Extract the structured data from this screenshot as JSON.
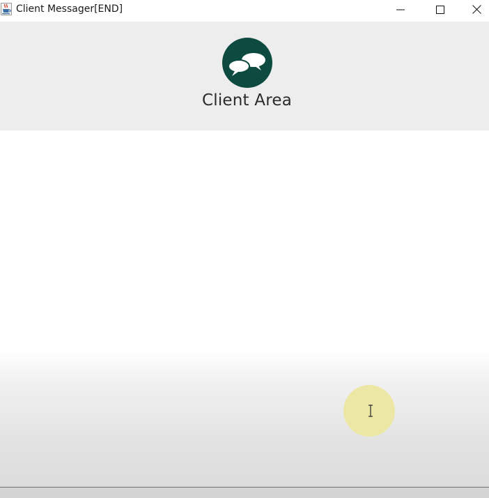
{
  "window": {
    "title": "Client Messager[END]",
    "app_icon": "java-cup-icon",
    "controls": {
      "minimize": "minimize-icon",
      "maximize": "maximize-icon",
      "close": "close-icon"
    }
  },
  "header": {
    "logo": "chat-bubbles-icon",
    "title": "Client Area",
    "background_color": "#eeedee",
    "logo_color": "#0d4a40"
  },
  "content": {
    "cursor": "text-cursor-icon",
    "cursor_highlight_color": "#ece7a4"
  }
}
